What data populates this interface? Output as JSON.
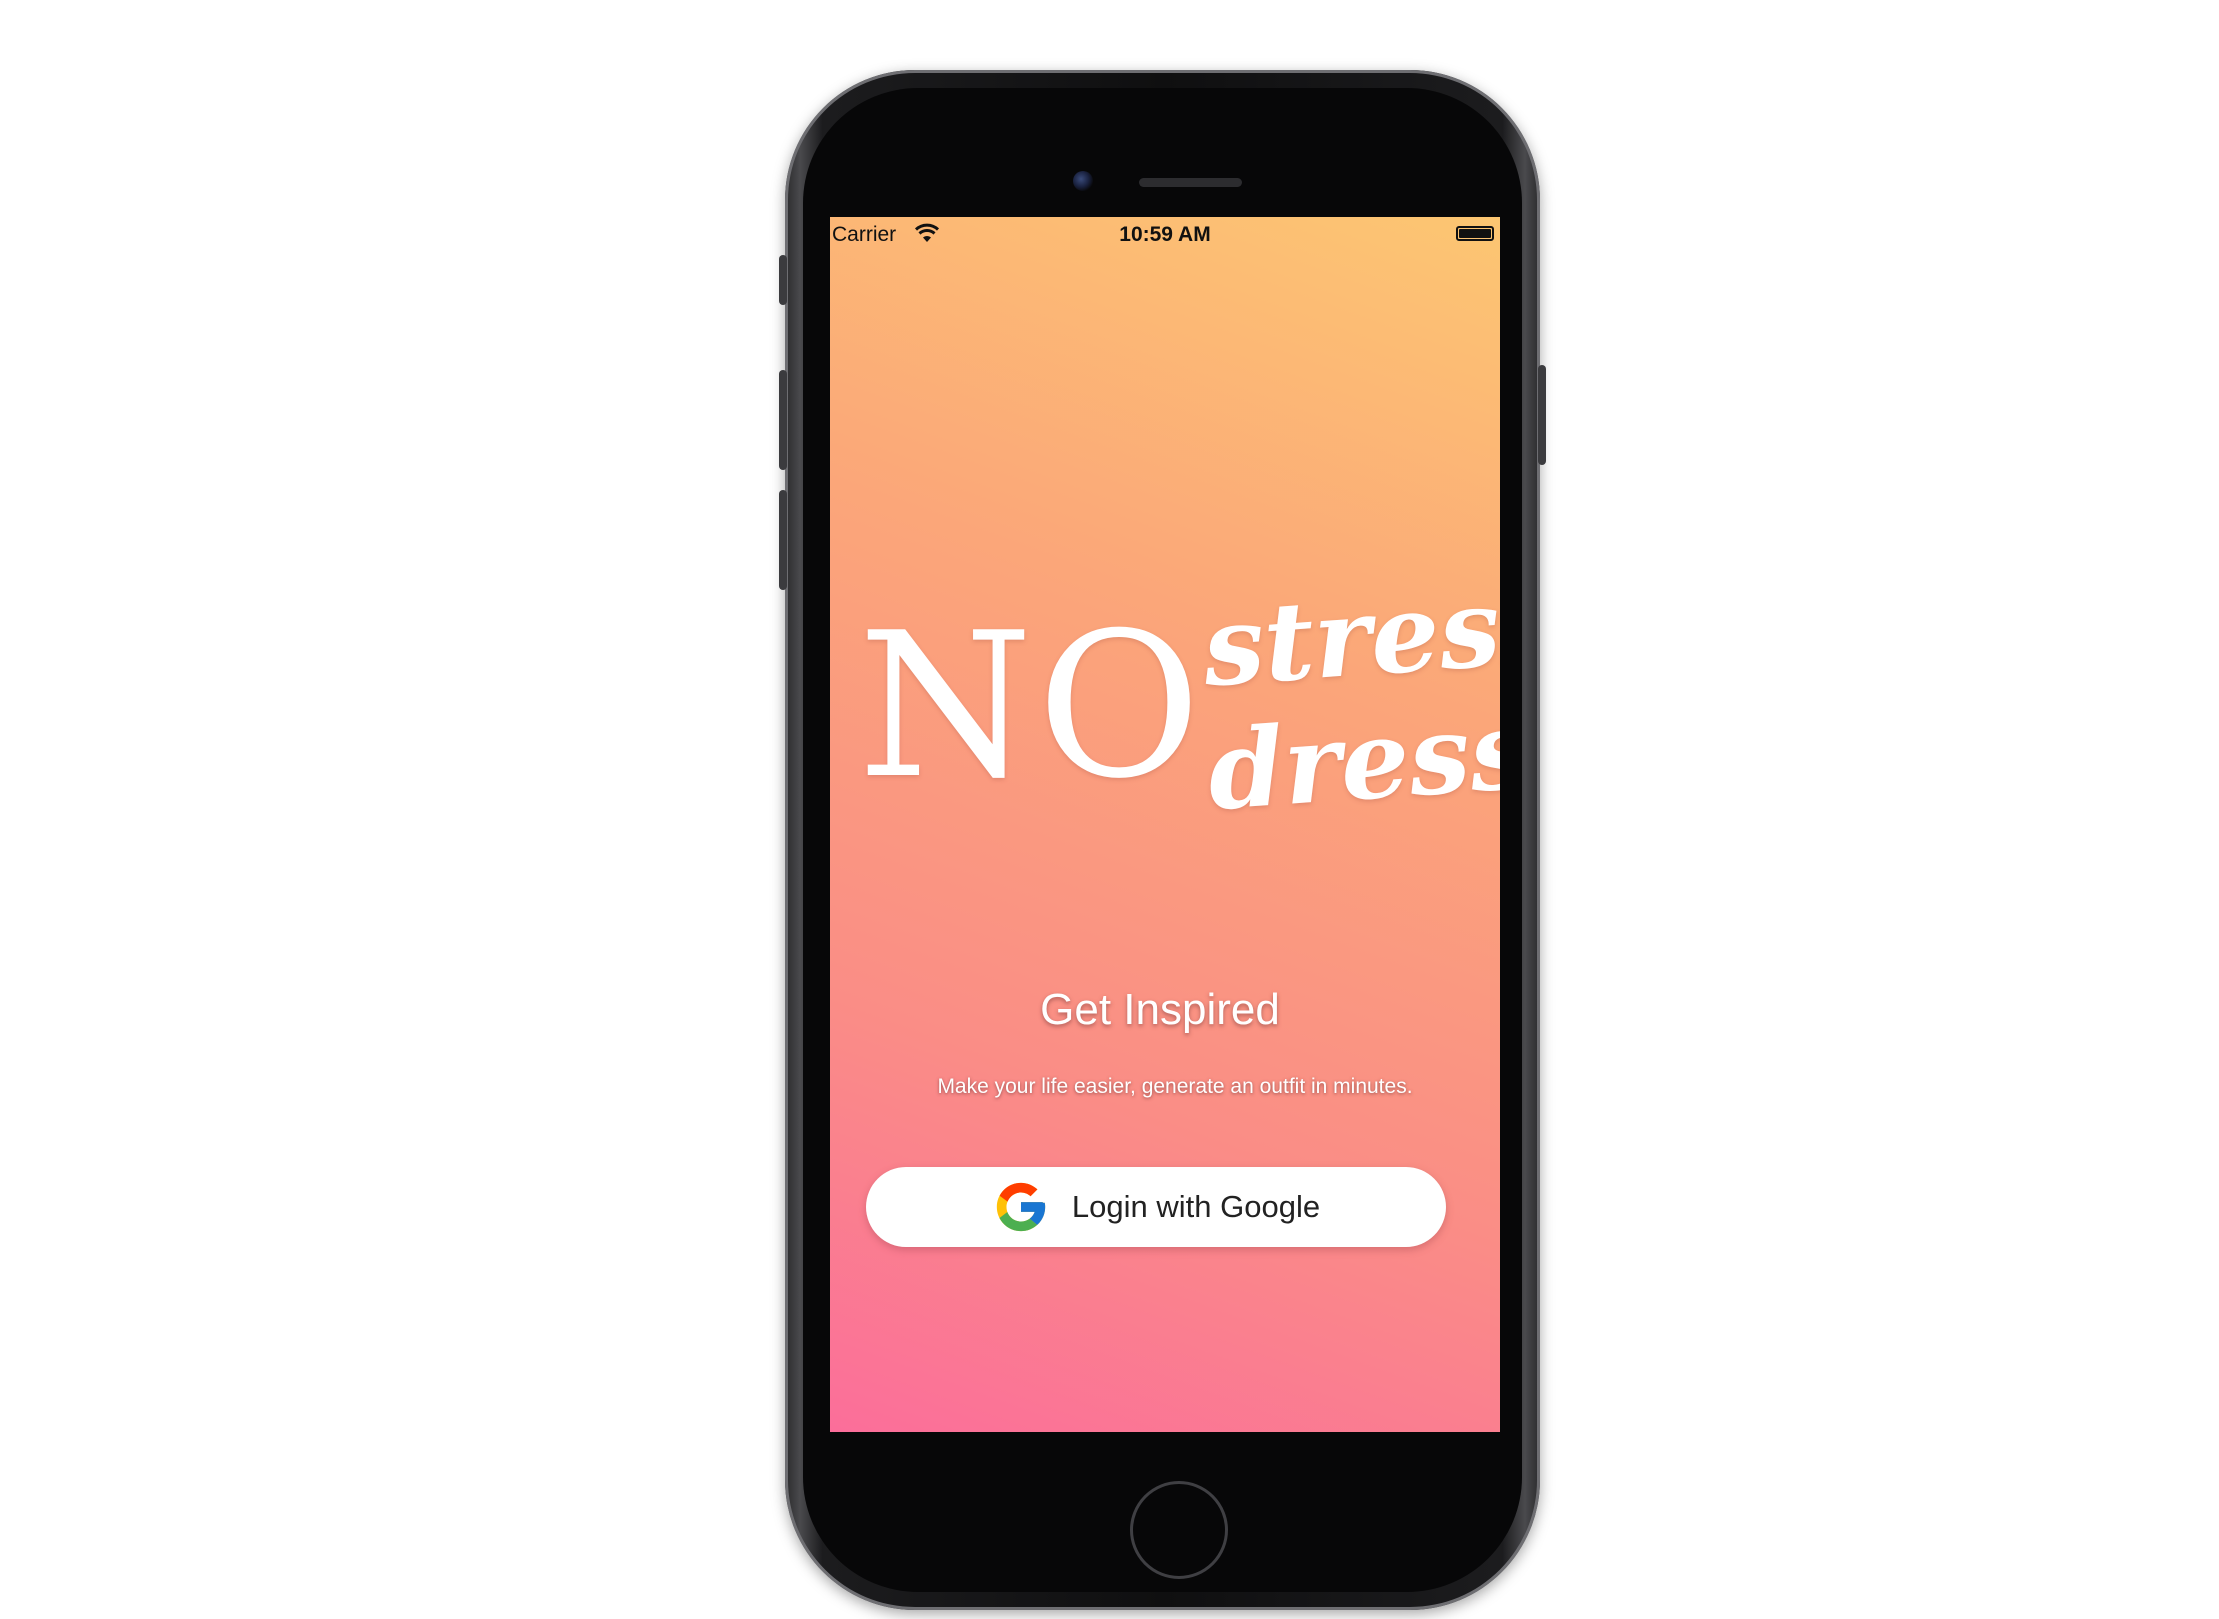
{
  "status_bar": {
    "carrier": "Carrier",
    "time": "10:59 AM",
    "wifi_icon": "wifi-icon",
    "battery_icon": "battery-icon"
  },
  "logo": {
    "no": "NO",
    "stress": "stress",
    "dress": "dress"
  },
  "headline": "Get Inspired",
  "subline": "Make your life easier, generate an outfit in minutes.",
  "login_button": {
    "label": "Login with Google",
    "icon": "google-icon"
  },
  "colors": {
    "gradient_top": "#fcc672",
    "gradient_bottom": "#fb6e9a",
    "button_bg": "#ffffff",
    "text": "#ffffff"
  }
}
